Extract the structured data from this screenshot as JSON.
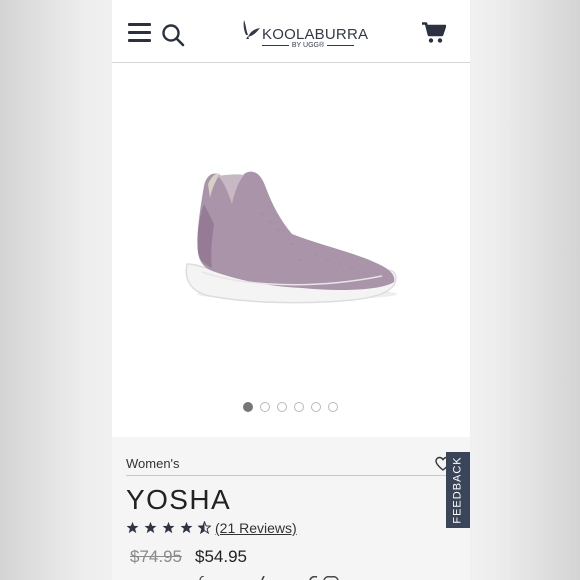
{
  "header": {
    "brand_name": "KOOLABURRA",
    "brand_sub": "BY UGG®",
    "icons": [
      "menu-icon",
      "search-icon",
      "cart-icon"
    ]
  },
  "gallery": {
    "image_count": 6,
    "active_index": 0
  },
  "product": {
    "breadcrumb": "Women's",
    "name": "YOSHA",
    "rating": 4.5,
    "reviews_label": "(21 Reviews)",
    "original_price": "$74.95",
    "sale_price": "$54.95"
  },
  "feedback": {
    "label": "FEEDBACK"
  },
  "colors": {
    "brand_navy": "#2b3140",
    "shoe_mauve": "#a893a8",
    "feedback_bg": "#3b4559"
  }
}
